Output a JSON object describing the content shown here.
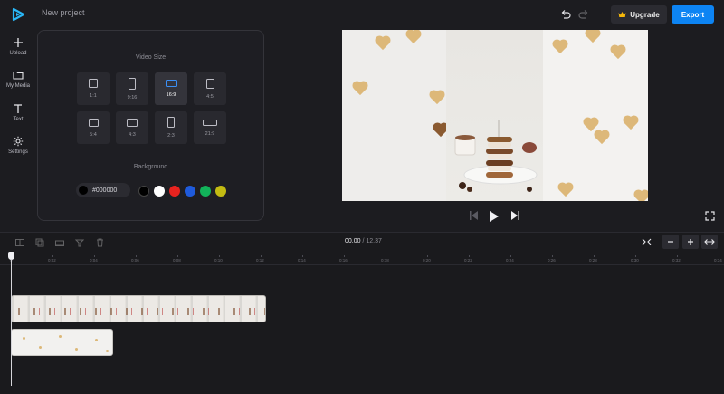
{
  "header": {
    "project_title": "New project",
    "upgrade_label": "Upgrade",
    "export_label": "Export"
  },
  "nav": {
    "items": [
      {
        "label": "Upload",
        "icon": "plus-icon"
      },
      {
        "label": "My Media",
        "icon": "folder-icon"
      },
      {
        "label": "Text",
        "icon": "text-icon"
      },
      {
        "label": "Settings",
        "icon": "gear-icon"
      }
    ]
  },
  "panel": {
    "video_size_title": "Video Size",
    "sizes": [
      {
        "label": "1:1",
        "selected": false
      },
      {
        "label": "9:16",
        "selected": false
      },
      {
        "label": "16:9",
        "selected": true
      },
      {
        "label": "4:5",
        "selected": false
      },
      {
        "label": "5:4",
        "selected": false
      },
      {
        "label": "4:3",
        "selected": false
      },
      {
        "label": "2:3",
        "selected": false
      },
      {
        "label": "21:9",
        "selected": false
      }
    ],
    "background_title": "Background",
    "background_hex": "#000000",
    "swatches": [
      "#000000",
      "#ffffff",
      "#e8231f",
      "#1f5bdc",
      "#12b35a",
      "#c3bb12"
    ]
  },
  "timeline": {
    "current_time": "00.00",
    "separator": "/",
    "total_time": "12.37",
    "ruler_ticks": [
      "0",
      "0:02",
      "0:04",
      "0:06",
      "0:08",
      "0:10",
      "0:12",
      "0:14",
      "0:16",
      "0:18",
      "0:20",
      "0:22",
      "0:24",
      "0:26",
      "0:28",
      "0:30",
      "0:32",
      "0:34"
    ]
  },
  "colors": {
    "accent": "#0d84f3",
    "selected_border": "#3b8ff5"
  }
}
